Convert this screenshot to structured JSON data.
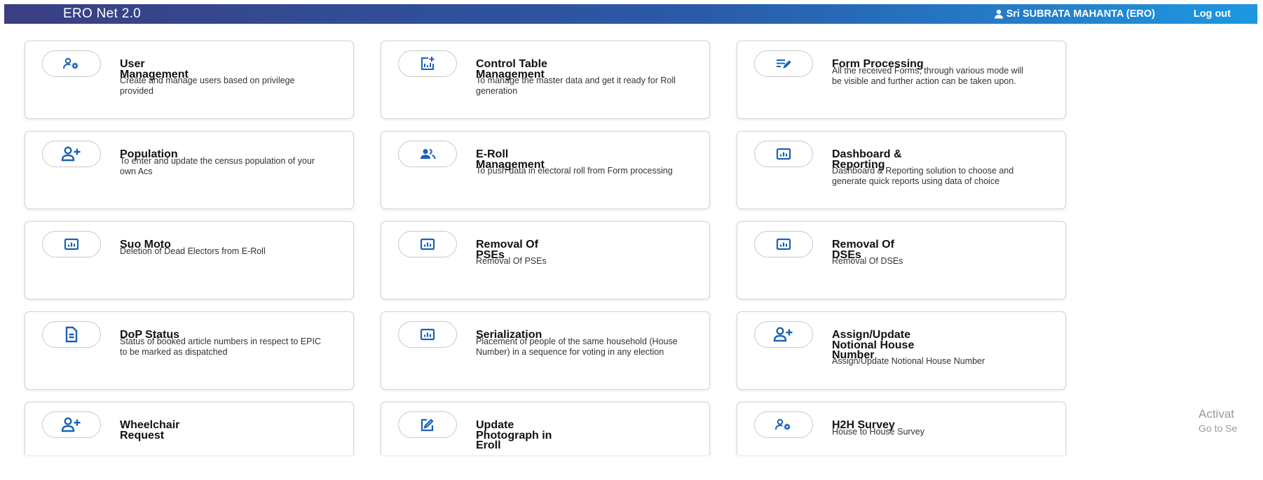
{
  "header": {
    "app_title": "ERO Net 2.0",
    "user_name": "Sri SUBRATA MAHANTA (ERO)",
    "logout_label": "Log out",
    "user_icon": "user-icon"
  },
  "colors": {
    "header_start": "#3a3f82",
    "header_end": "#1e97e1",
    "icon_blue": "#1b62b3"
  },
  "cards": [
    {
      "title": "User\nManagement",
      "desc": "Create and manage users based on privilege provided",
      "icon": "users-gear-icon"
    },
    {
      "title": "Control Table\nManagement",
      "desc": "To manage the master data and get it ready for Roll generation",
      "icon": "chart-add-icon"
    },
    {
      "title": "Form Processing",
      "desc": "All the received Forms, through various mode will be visible and further action can be taken upon.",
      "icon": "edit-lines-icon"
    },
    {
      "title": "Population",
      "desc": "To enter and update the census population of your own Acs",
      "icon": "person-add-icon"
    },
    {
      "title": "E-Roll\nManagement",
      "desc": "To push data in electoral roll from Form processing",
      "icon": "group-icon"
    },
    {
      "title": "Dashboard &\nReporting",
      "desc": "Dashboard & Reporting solution to choose and generate quick reports using data of choice",
      "icon": "bar-chart-icon"
    },
    {
      "title": "Suo Moto",
      "desc": "Deletion of Dead Electors from E-Roll",
      "icon": "bar-chart-icon"
    },
    {
      "title": "Removal Of\nPSEs",
      "desc": "Removal Of PSEs",
      "icon": "bar-chart-icon"
    },
    {
      "title": "Removal Of\nDSEs",
      "desc": "Removal Of DSEs",
      "icon": "bar-chart-icon"
    },
    {
      "title": "DoP Status",
      "desc": "Status of booked article numbers in respect to EPIC to be marked as dispatched",
      "icon": "document-icon"
    },
    {
      "title": "Serialization",
      "desc": "Placement of people of the same household (House Number) in a sequence for voting in any election",
      "icon": "bar-chart-icon"
    },
    {
      "title": "Assign/Update\nNotional House\nNumber",
      "desc": "Assign/Update Notional House Number",
      "icon": "person-add-icon"
    },
    {
      "title": "Wheelchair\nRequest",
      "desc": "",
      "icon": "person-add-icon"
    },
    {
      "title": "Update\nPhotograph in\nEroll",
      "desc": "",
      "icon": "photo-edit-icon"
    },
    {
      "title": "H2H Survey",
      "desc": "House to House Survey",
      "icon": "users-gear-icon"
    }
  ],
  "watermark": {
    "line1": "Activat",
    "line2": "Go to Se"
  }
}
